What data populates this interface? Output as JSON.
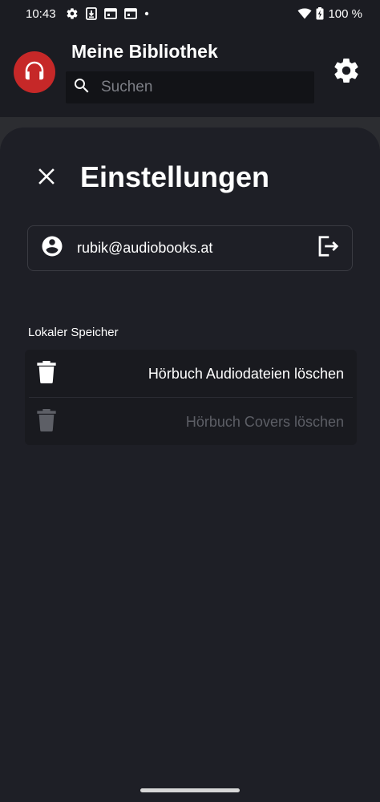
{
  "status_bar": {
    "time": "10:43",
    "battery": "100 %",
    "icons": [
      "settings-icon",
      "download-icon",
      "calendar-icon",
      "calendar-icon",
      "dot-icon",
      "wifi-icon",
      "battery-charging-icon"
    ]
  },
  "app_bar": {
    "title": "Meine Bibliothek",
    "search_placeholder": "Suchen",
    "avatar_icon": "headphones-icon",
    "avatar_color": "#c62828",
    "settings_icon": "gear-icon"
  },
  "settings_sheet": {
    "title": "Einstellungen",
    "account": {
      "email": "rubik@audiobooks.at",
      "account_icon": "account-circle-icon",
      "logout_icon": "logout-icon"
    },
    "local_storage": {
      "section_label": "Lokaler Speicher",
      "items": [
        {
          "label": "Hörbuch Audiodateien löschen",
          "icon": "trash-icon",
          "enabled": true
        },
        {
          "label": "Hörbuch Covers löschen",
          "icon": "trash-icon",
          "enabled": false
        }
      ]
    }
  },
  "colors": {
    "background": "#1b1c22",
    "sheet": "#1e1f26",
    "accent": "#c62828",
    "disabled_text": "#5d5f66"
  }
}
